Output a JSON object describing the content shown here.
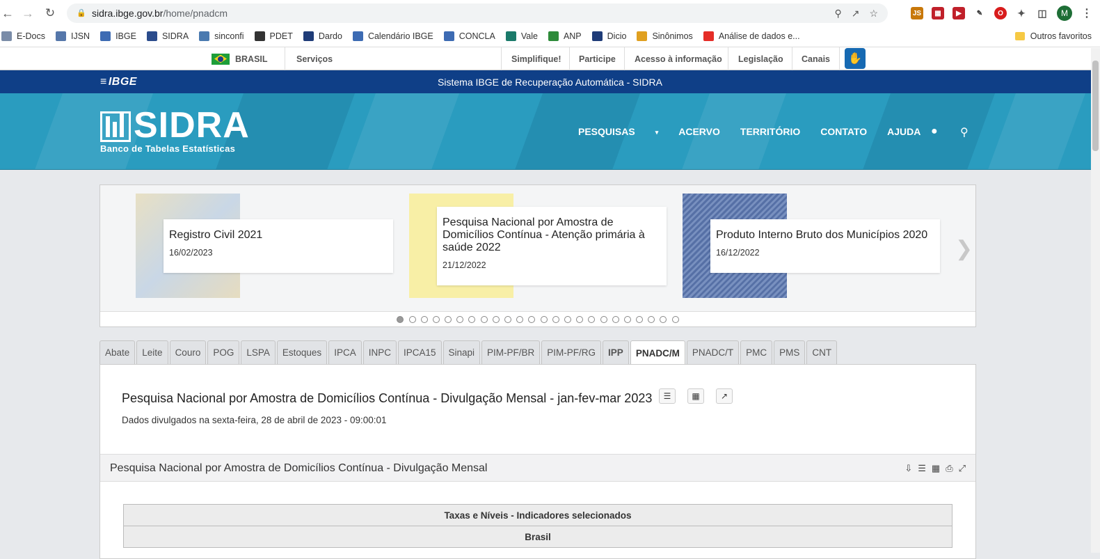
{
  "browser": {
    "url_host": "sidra.ibge.gov.br",
    "url_path": "/home/pnadcm",
    "profile_initial": "M"
  },
  "bookmarks": [
    {
      "label": "E-Docs",
      "color": "#7a8ca8"
    },
    {
      "label": "IJSN",
      "color": "#5577aa"
    },
    {
      "label": "IBGE",
      "color": "#3d6bb3"
    },
    {
      "label": "SIDRA",
      "color": "#2b4c8c"
    },
    {
      "label": "sinconfi",
      "color": "#4a7ab0"
    },
    {
      "label": "PDET",
      "color": "#333333"
    },
    {
      "label": "Dardo",
      "color": "#1f3c78"
    },
    {
      "label": "Calendário IBGE",
      "color": "#3d6bb3"
    },
    {
      "label": "CONCLA",
      "color": "#3d6bb3"
    },
    {
      "label": "Vale",
      "color": "#1b7a6a"
    },
    {
      "label": "ANP",
      "color": "#2e8b3a"
    },
    {
      "label": "Dicio",
      "color": "#1f3c78"
    },
    {
      "label": "Sinônimos",
      "color": "#e0a020"
    },
    {
      "label": "Análise de dados e...",
      "color": "#e52d27"
    }
  ],
  "bookmarks_other": "Outros favoritos",
  "govbar": {
    "brasil": "BRASIL",
    "servicos": "Serviços",
    "links": [
      "Simplifique!",
      "Participe",
      "Acesso à informação",
      "Legislação",
      "Canais"
    ]
  },
  "ibgebar": {
    "logo": "IBGE",
    "title": "Sistema IBGE de Recuperação Automática - SIDRA"
  },
  "hero": {
    "logo_text": "SIDRA",
    "logo_sub": "Banco de Tabelas Estatísticas",
    "nav": [
      "PESQUISAS",
      "ACERVO",
      "TERRITÓRIO",
      "CONTATO",
      "AJUDA"
    ]
  },
  "carousel": {
    "slides": [
      {
        "title": "Registro Civil 2021",
        "date": "16/02/2023"
      },
      {
        "title": "Pesquisa Nacional por Amostra de Domicílios Contínua - Atenção primária à saúde 2022",
        "date": "21/12/2022"
      },
      {
        "title": "Produto Interno Bruto dos Municípios 2020",
        "date": "16/12/2022"
      }
    ],
    "dot_count": 24,
    "active_dot": 0
  },
  "tabs": [
    "Abate",
    "Leite",
    "Couro",
    "POG",
    "LSPA",
    "Estoques",
    "IPCA",
    "INPC",
    "IPCA15",
    "Sinapi",
    "PIM-PF/BR",
    "PIM-PF/RG",
    "IPP",
    "PNADC/M",
    "PNADC/T",
    "PMC",
    "PMS",
    "CNT"
  ],
  "active_tab": "PNADC/M",
  "panel": {
    "title": "Pesquisa Nacional por Amostra de Domicílios Contínua - Divulgação Mensal - jan-fev-mar 2023",
    "date": "Dados divulgados na sexta-feira, 28 de abril de 2023 - 09:00:01",
    "subtitle": "Pesquisa Nacional por Amostra de Domicílios Contínua - Divulgação Mensal",
    "table_header": "Taxas e Níveis - Indicadores selecionados",
    "table_subheader": "Brasil"
  }
}
